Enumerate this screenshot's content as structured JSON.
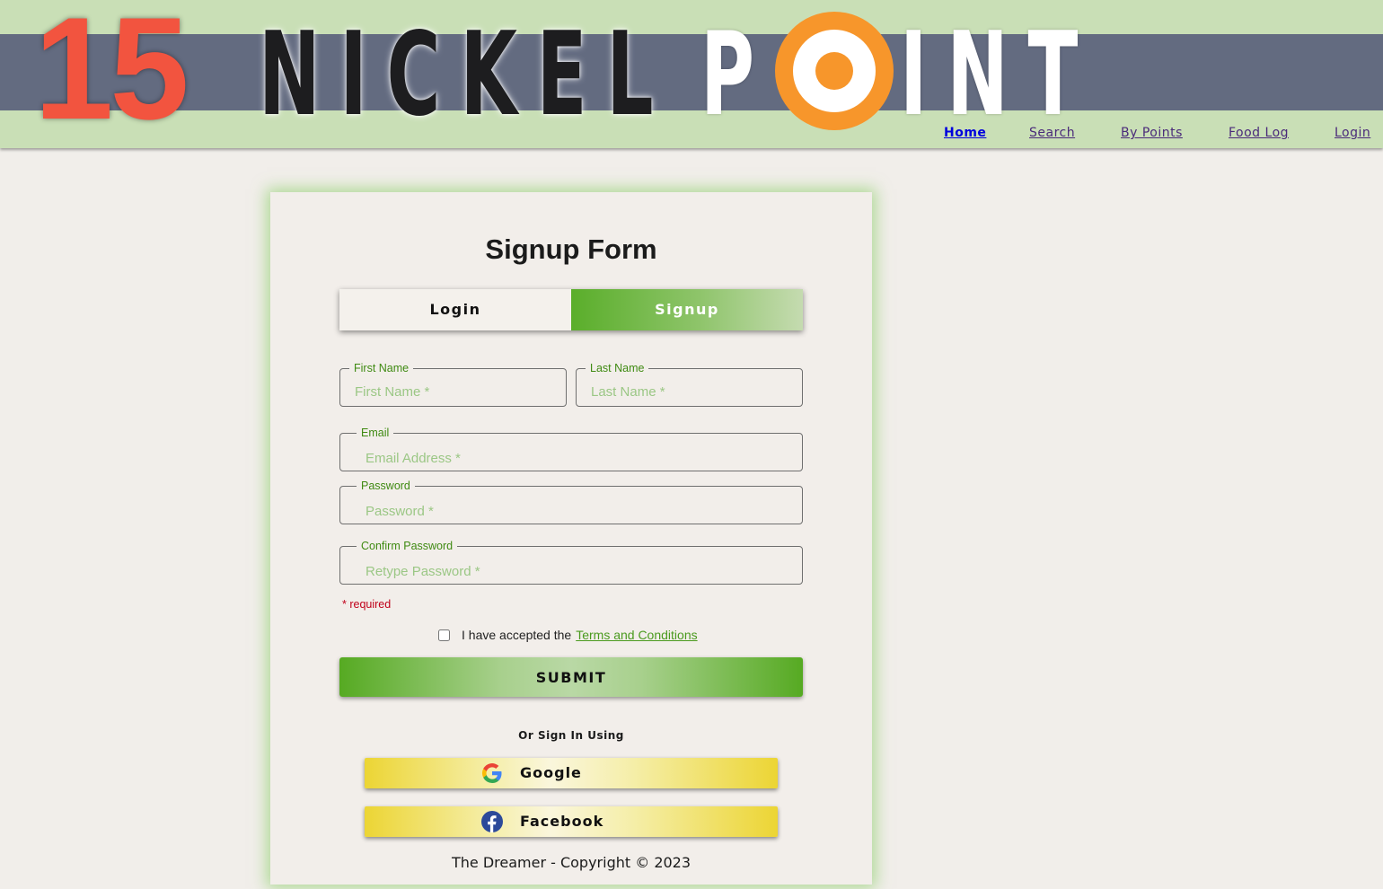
{
  "brand": {
    "number": "15",
    "word1": "NICKEL",
    "word2_p": "P",
    "word2_rest": "INT"
  },
  "nav": {
    "items": [
      {
        "label": "Home",
        "active": true
      },
      {
        "label": "Search",
        "active": false
      },
      {
        "label": "By Points",
        "active": false
      },
      {
        "label": "Food Log",
        "active": false
      },
      {
        "label": "Login",
        "active": false
      }
    ]
  },
  "form": {
    "title": "Signup Form",
    "tabs": {
      "login": "Login",
      "signup": "Signup",
      "selected": "Signup"
    },
    "fields": {
      "first_name": {
        "legend": "First Name",
        "placeholder": "First Name *",
        "value": ""
      },
      "last_name": {
        "legend": "Last Name",
        "placeholder": "Last Name *",
        "value": ""
      },
      "email": {
        "legend": "Email",
        "placeholder": "Email Address *",
        "value": ""
      },
      "password": {
        "legend": "Password",
        "placeholder": "Password *",
        "value": ""
      },
      "confirm_password": {
        "legend": "Confirm Password",
        "placeholder": "Retype Password *",
        "value": ""
      }
    },
    "required_note": "* required",
    "terms": {
      "prefix": "I have accepted the",
      "link": "Terms and Conditions",
      "checked": false
    },
    "submit": "SUBMIT",
    "or_sign_in": "Or Sign In Using",
    "social": {
      "google": "Google",
      "facebook": "Facebook"
    },
    "footer": "The Dreamer - Copyright © 2023"
  },
  "colors": {
    "accent_green": "#5aae2a",
    "header_bg": "#c9dfb6",
    "header_band": "#636b80",
    "logo_red": "#f2543f",
    "logo_orange": "#f7962b",
    "social_yellow": "#ecd534"
  },
  "icons": {
    "google": "google-icon",
    "facebook": "facebook-icon",
    "logo_o": "target-circle-icon"
  }
}
